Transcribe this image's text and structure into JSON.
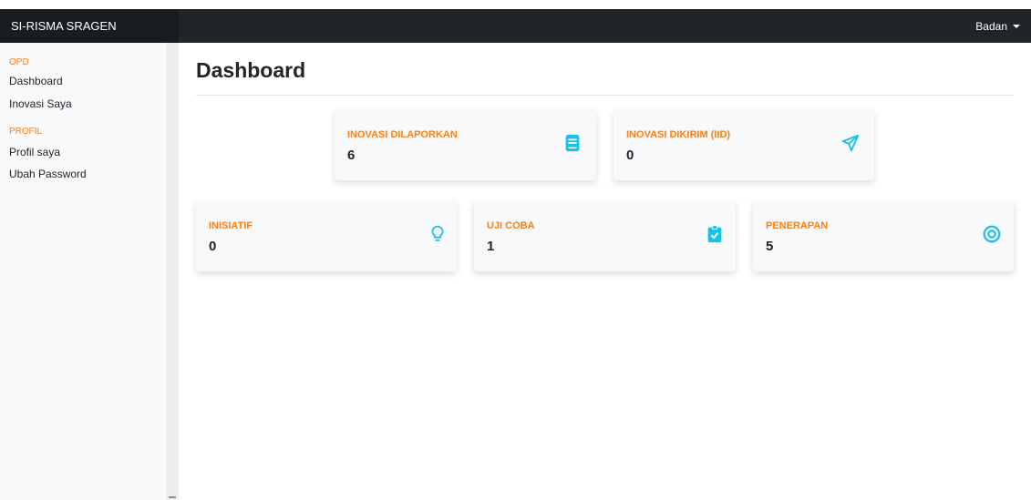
{
  "app": {
    "brand": "SI-RISMA SRAGEN"
  },
  "header": {
    "user_label": "Badan"
  },
  "sidebar": {
    "sections": [
      {
        "heading": "OPD",
        "items": [
          {
            "label": "Dashboard"
          },
          {
            "label": "Inovasi Saya"
          }
        ]
      },
      {
        "heading": "PROFIL",
        "items": [
          {
            "label": "Profil saya"
          },
          {
            "label": "Ubah Password"
          }
        ]
      }
    ]
  },
  "main": {
    "title": "Dashboard",
    "cards": [
      {
        "label": "INOVASI DILAPORKAN",
        "value": "6",
        "icon": "book-icon"
      },
      {
        "label": "INOVASI DIKIRIM (IID)",
        "value": "0",
        "icon": "paper-plane-icon"
      },
      {
        "label": "INISIATIF",
        "value": "0",
        "icon": "lightbulb-icon"
      },
      {
        "label": "UJI COBA",
        "value": "1",
        "icon": "clipboard-check-icon"
      },
      {
        "label": "PENERAPAN",
        "value": "5",
        "icon": "target-icon"
      }
    ]
  },
  "colors": {
    "accent_label": "#fd7e14",
    "icon": "#17c1e8",
    "topbar": "#212529",
    "sidebar_bg": "#f8f9fa"
  }
}
